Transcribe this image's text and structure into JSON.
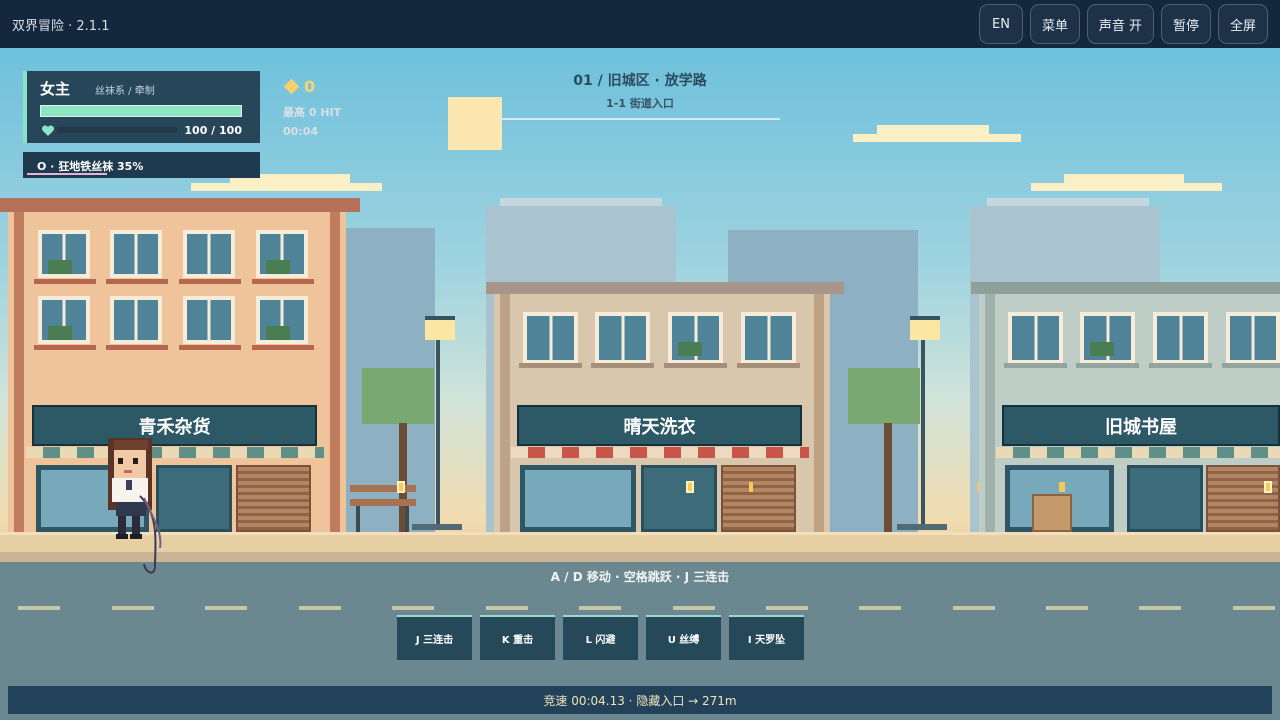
{
  "app": {
    "title": "双界冒险 · 2.1.1"
  },
  "toolbar": {
    "lang": "EN",
    "menu": "菜单",
    "sound": "声音 开",
    "pause": "暂停",
    "fullscreen": "全屏"
  },
  "hud": {
    "name": "女主",
    "class": "丝袜系 / 牵制",
    "hp": "100 / 100",
    "hp_fraction": 1.0,
    "skill": "O · 狂地铁丝袜  35%",
    "skill_fraction": 0.35,
    "gems": "0",
    "best": "最高 0 HIT",
    "time": "00:04"
  },
  "stage": {
    "title": "01 / 旧城区 · 放学路",
    "sub": "1-1  街道入口"
  },
  "shops": {
    "shop1": "青禾杂货",
    "shop2": "晴天洗衣",
    "shop3": "旧城书屋"
  },
  "controls_hint": "A / D 移动 · 空格跳跃 · J 三连击",
  "skills": [
    {
      "label": "J 三连击"
    },
    {
      "label": "K 重击"
    },
    {
      "label": "L 闪避"
    },
    {
      "label": "U 丝缚"
    },
    {
      "label": "I 天罗坠"
    }
  ],
  "race": "竞速 00:04.13 · 隐藏入口 → 271m",
  "colors": {
    "accent": "#8ce3c3",
    "gem": "#f4d26b",
    "topbar": "#14283d"
  }
}
